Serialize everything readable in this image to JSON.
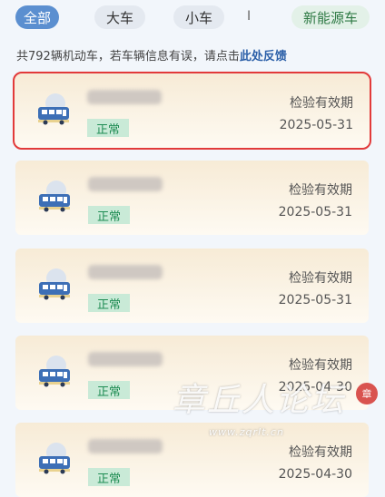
{
  "filters": {
    "all": "全部",
    "large": "大车",
    "small": "小车",
    "separator": "I",
    "new_energy": "新能源车",
    "accent": "#5b8fd0",
    "green": "#2f7a45"
  },
  "notice": {
    "prefix": "共792辆机动车，若车辆信息有误，请点击",
    "link": "此处反馈"
  },
  "vehicles": [
    {
      "status": "正常",
      "label": "检验有效期",
      "date": "2025-05-31",
      "selected": true
    },
    {
      "status": "正常",
      "label": "检验有效期",
      "date": "2025-05-31"
    },
    {
      "status": "正常",
      "label": "检验有效期",
      "date": "2025-05-31"
    },
    {
      "status": "正常",
      "label": "检验有效期",
      "date": "2025-04-30"
    },
    {
      "status": "正常",
      "label": "检验有效期",
      "date": "2025-04-30"
    }
  ],
  "icons": {
    "vehicle": "bus-icon"
  },
  "colors": {
    "selected_border": "#e23a3a",
    "badge_bg": "#c9ead7",
    "badge_text": "#1f8c53"
  },
  "watermark": {
    "text": "章丘人论坛",
    "url": "www.zqrlt.cn",
    "seal": "章"
  }
}
